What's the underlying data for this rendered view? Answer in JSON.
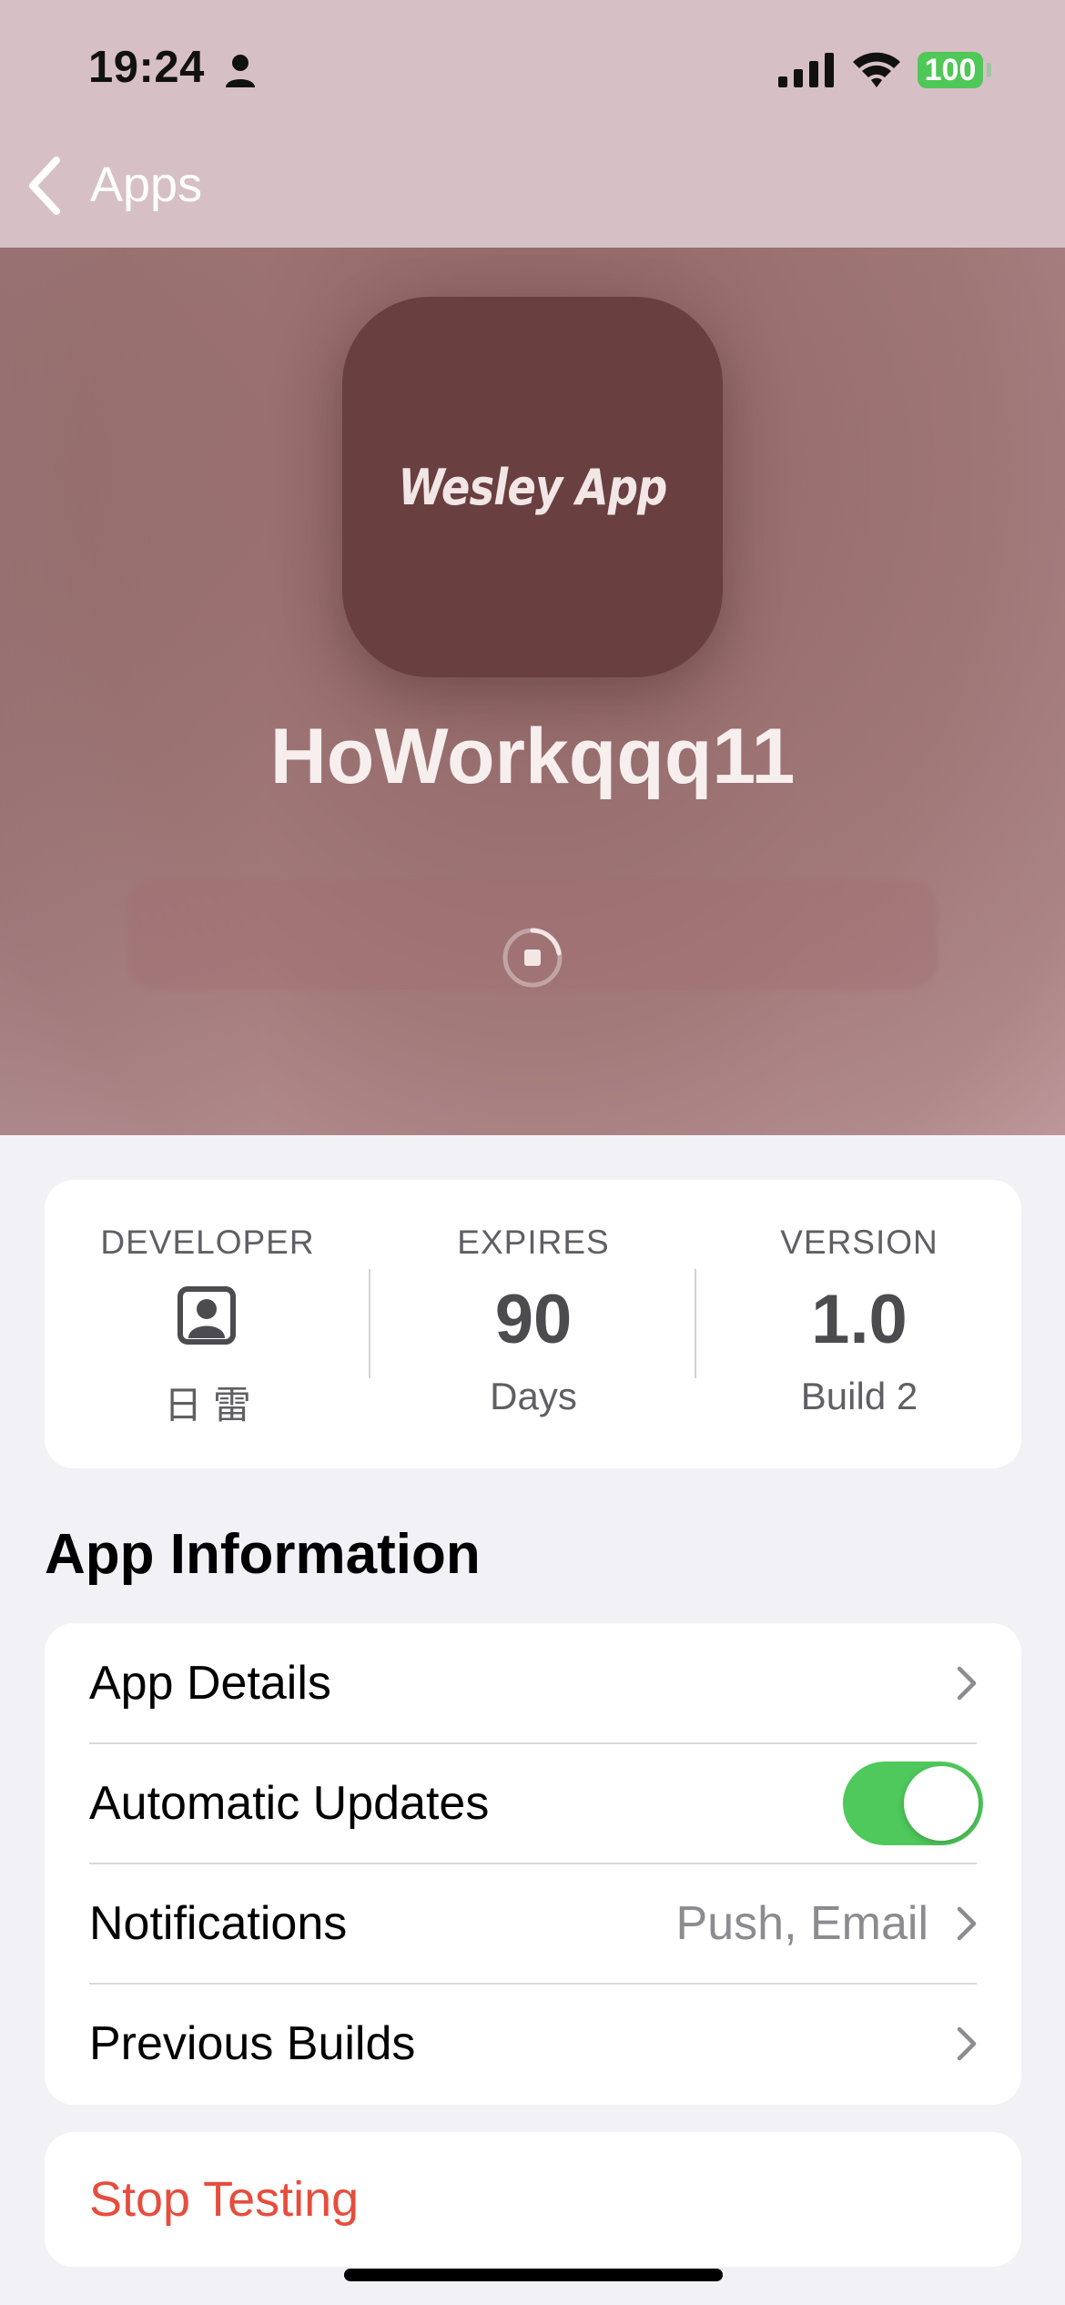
{
  "status_bar": {
    "time": "19:24",
    "battery": "100"
  },
  "nav": {
    "back_label": "Apps"
  },
  "app": {
    "icon_text": "Wesley App",
    "name": "HoWorkqqq11"
  },
  "info": {
    "developer": {
      "heading": "DEVELOPER",
      "name": "日 雷"
    },
    "expires": {
      "heading": "EXPIRES",
      "value": "90",
      "unit": "Days"
    },
    "version": {
      "heading": "VERSION",
      "value": "1.0",
      "build": "Build 2"
    }
  },
  "section": {
    "title": "App Information"
  },
  "rows": {
    "app_details": {
      "label": "App Details"
    },
    "automatic_updates": {
      "label": "Automatic Updates",
      "enabled": true
    },
    "notifications": {
      "label": "Notifications",
      "value": "Push, Email"
    },
    "previous_builds": {
      "label": "Previous Builds"
    }
  },
  "actions": {
    "stop_testing": "Stop Testing"
  },
  "colors": {
    "accent_green": "#4fc85c",
    "destructive_red": "#e64d3d",
    "hero_tint": "#996f6f"
  }
}
